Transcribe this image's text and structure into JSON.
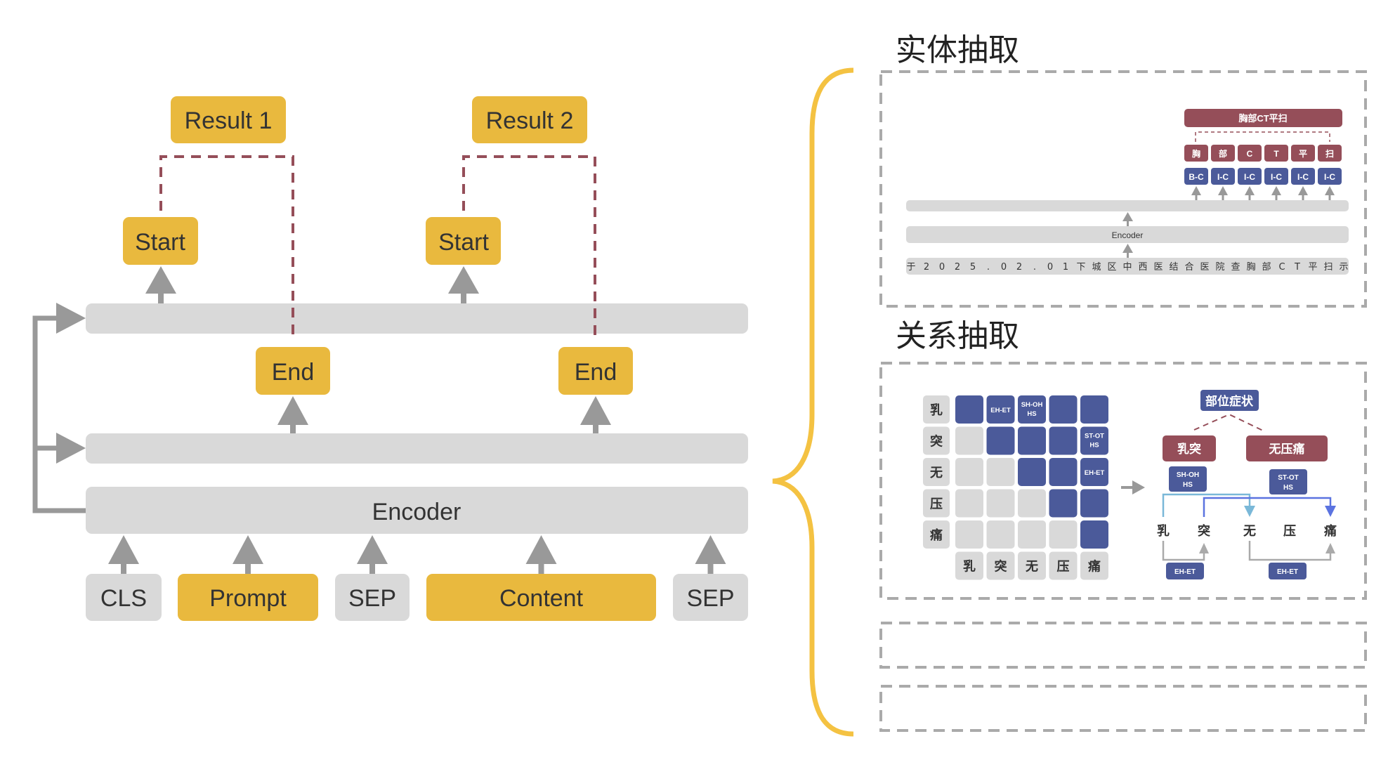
{
  "colors": {
    "yellow": "#E9B93E",
    "gray_box": "#D9D9D9",
    "arrow_gray": "#999999",
    "maroon": "#954E59",
    "navy": "#4B5A9A",
    "brace": "#F4C242",
    "dash_gray": "#AAAAAA",
    "light_blue": "#7AB8D8",
    "bright_blue": "#5B73E0"
  },
  "left": {
    "results": [
      "Result 1",
      "Result 2"
    ],
    "start_label": "Start",
    "end_label": "End",
    "encoder_label": "Encoder",
    "inputs": [
      {
        "label": "CLS",
        "kind": "special"
      },
      {
        "label": "Prompt",
        "kind": "highlight"
      },
      {
        "label": "SEP",
        "kind": "special"
      },
      {
        "label": "Content",
        "kind": "highlight"
      },
      {
        "label": "SEP",
        "kind": "special"
      }
    ]
  },
  "entity": {
    "title": "实体抽取",
    "entity_label": "胸部CT平扫",
    "chars": [
      "胸",
      "部",
      "C",
      "T",
      "平",
      "扫"
    ],
    "tags": [
      "B-C",
      "I-C",
      "I-C",
      "I-C",
      "I-C",
      "I-C"
    ],
    "encoder_label": "Encoder",
    "tokens": [
      "于",
      "2",
      "0",
      "2",
      "5",
      ".",
      "0",
      "2",
      ".",
      "0",
      "1",
      "下",
      "城",
      "区",
      "中",
      "西",
      "医",
      "结",
      "合",
      "医",
      "院",
      "查",
      "胸",
      "部",
      "C",
      "T",
      "平",
      "扫",
      "示"
    ]
  },
  "relation": {
    "title": "关系抽取",
    "chars": [
      "乳",
      "突",
      "无",
      "压",
      "痛"
    ],
    "matrix": [
      [
        {
          "on": true,
          "label": ""
        },
        {
          "on": true,
          "label": "EH-ET"
        },
        {
          "on": true,
          "label": "SH-OH HS"
        },
        {
          "on": true,
          "label": ""
        },
        {
          "on": true,
          "label": ""
        }
      ],
      [
        {
          "on": false,
          "label": ""
        },
        {
          "on": true,
          "label": ""
        },
        {
          "on": true,
          "label": ""
        },
        {
          "on": true,
          "label": ""
        },
        {
          "on": true,
          "label": "ST-OT HS"
        }
      ],
      [
        {
          "on": false,
          "label": ""
        },
        {
          "on": false,
          "label": ""
        },
        {
          "on": true,
          "label": ""
        },
        {
          "on": true,
          "label": ""
        },
        {
          "on": true,
          "label": "EH-ET"
        }
      ],
      [
        {
          "on": false,
          "label": ""
        },
        {
          "on": false,
          "label": ""
        },
        {
          "on": false,
          "label": ""
        },
        {
          "on": true,
          "label": ""
        },
        {
          "on": true,
          "label": ""
        }
      ],
      [
        {
          "on": false,
          "label": ""
        },
        {
          "on": false,
          "label": ""
        },
        {
          "on": false,
          "label": ""
        },
        {
          "on": false,
          "label": ""
        },
        {
          "on": true,
          "label": ""
        }
      ]
    ],
    "relation_type": "部位症状",
    "head_entity": "乳突",
    "tail_entity": "无压痛",
    "head_tag": "SH-OH HS",
    "tail_tag": "ST-OT HS",
    "head_span_tag": "EH-ET",
    "tail_span_tag": "EH-ET"
  }
}
